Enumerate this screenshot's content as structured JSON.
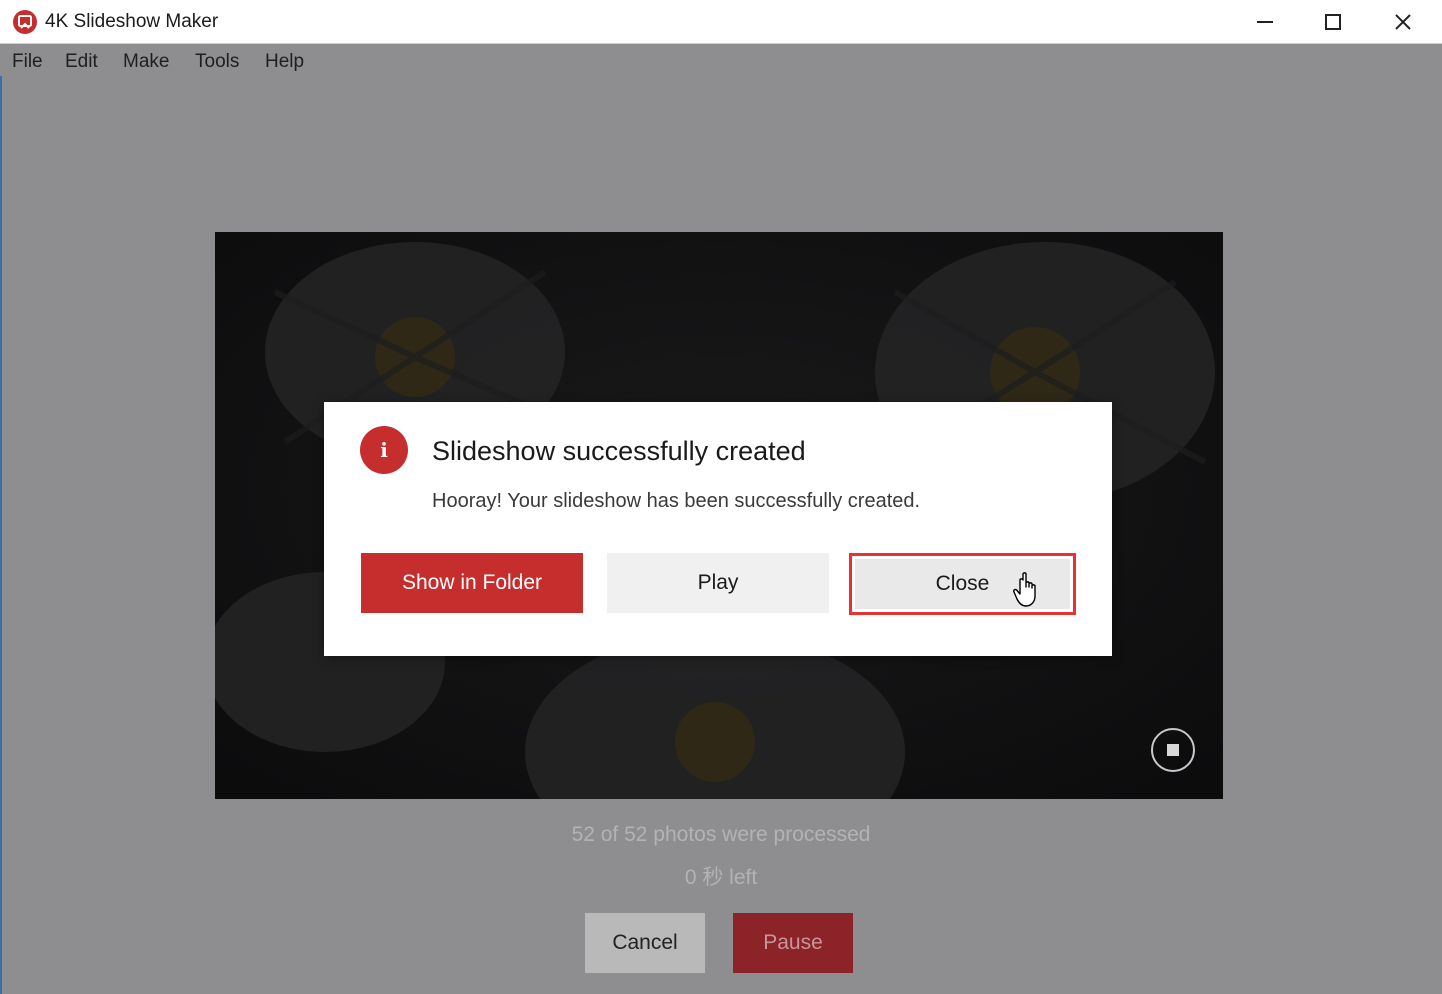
{
  "window": {
    "title": "4K Slideshow Maker"
  },
  "menu": {
    "items": [
      "File",
      "Edit",
      "Make",
      "Tools",
      "Help"
    ]
  },
  "progress": {
    "processed_text": "52 of 52 photos were processed",
    "left_text": "0 秒 left",
    "cancel_label": "Cancel",
    "pause_label": "Pause"
  },
  "dialog": {
    "title": "Slideshow successfully created",
    "message": "Hooray! Your slideshow has been successfully created.",
    "show_in_folder_label": "Show in Folder",
    "play_label": "Play",
    "close_label": "Close",
    "info_icon": "i"
  },
  "colors": {
    "accent": "#c62d2d",
    "highlight_border": "#e53232"
  }
}
